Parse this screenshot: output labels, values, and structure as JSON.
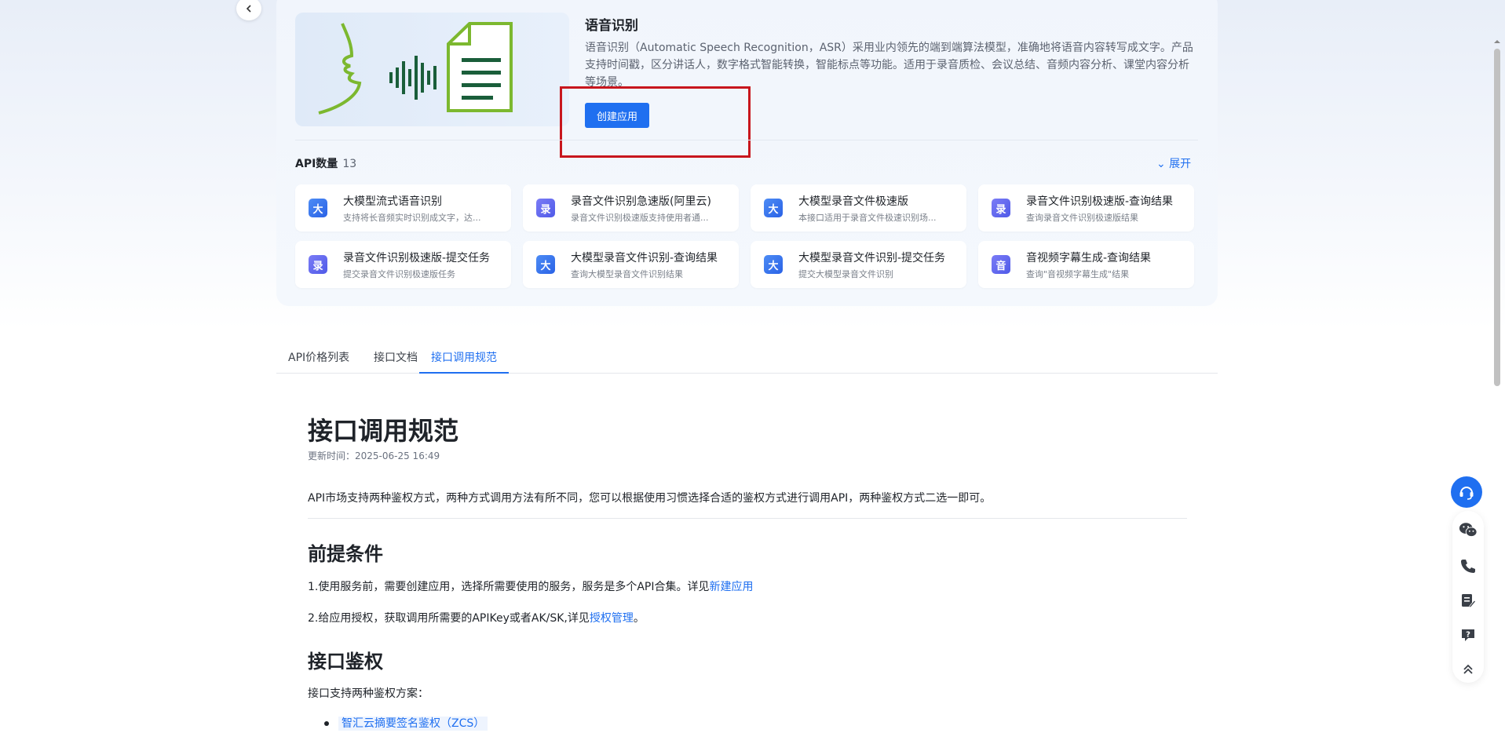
{
  "hero": {
    "title": "语音识别",
    "description": "语音识别（Automatic Speech Recognition，ASR）采用业内领先的端到端算法模型，准确地将语音内容转写成文字。产品支持时间戳，区分讲话人，数字格式智能转换，智能标点等功能。适用于录音质检、会议总结、音频内容分析、课堂内容分析等场景。",
    "create_button": "创建应用"
  },
  "api_section": {
    "label": "API数量",
    "count": "13",
    "expand_label": "⌄ 展开"
  },
  "apis": [
    {
      "icon": "大",
      "name": "大模型流式语音识别",
      "desc": "支持将长音频实时识别成文字，达..."
    },
    {
      "icon": "录",
      "name": "录音文件识别急速版(阿里云)",
      "desc": "录音文件识别极速版支持使用者通..."
    },
    {
      "icon": "大",
      "name": "大模型录音文件极速版",
      "desc": "本接口适用于录音文件极速识别场..."
    },
    {
      "icon": "录",
      "name": "录音文件识别极速版-查询结果",
      "desc": "查询录音文件识别极速版结果"
    },
    {
      "icon": "录",
      "name": "录音文件识别极速版-提交任务",
      "desc": "提交录音文件识别极速版任务"
    },
    {
      "icon": "大",
      "name": "大模型录音文件识别-查询结果",
      "desc": "查询大模型录音文件识别结果"
    },
    {
      "icon": "大",
      "name": "大模型录音文件识别-提交任务",
      "desc": "提交大模型录音文件识别"
    },
    {
      "icon": "音",
      "name": "音视频字幕生成-查询结果",
      "desc": "查询\"音视频字幕生成\"结果"
    }
  ],
  "tabs": [
    "API价格列表",
    "接口文档",
    "接口调用规范"
  ],
  "doc": {
    "title": "接口调用规范",
    "updated": "更新时间：2025-06-25 16:49",
    "intro": "API市场支持两种鉴权方式，两种方式调用方法有所不同，您可以根据使用习惯选择合适的鉴权方式进行调用API，两种鉴权方式二选一即可。",
    "h_prereq": "前提条件",
    "p1_text": "1.使用服务前，需要创建应用，选择所需要使用的服务，服务是多个API合集。详见",
    "p1_link": "新建应用",
    "p2_text": "2.给应用授权，获取调用所需要的APIKey或者AK/SK,详见",
    "p2_link": "授权管理",
    "p2_end": "。",
    "h_auth": "接口鉴权",
    "auth_intro": "接口支持两种鉴权方案：",
    "bullet1": "智汇云摘要签名鉴权（ZCS）"
  }
}
